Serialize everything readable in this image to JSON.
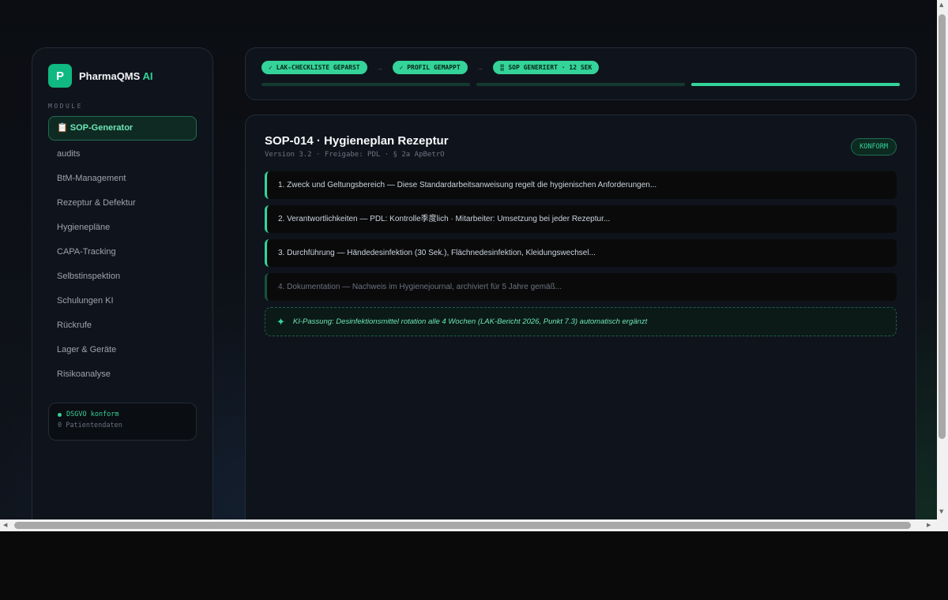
{
  "brand": {
    "logo_letter": "P",
    "name": "PharmaQMS",
    "suffix": "AI"
  },
  "sidebar": {
    "section_label": "MODULE",
    "items": [
      {
        "label": "📋 SOP-Generator",
        "active": true
      },
      {
        "label": "audits"
      },
      {
        "label": "BtM-Management"
      },
      {
        "label": "Rezeptur & Defektur"
      },
      {
        "label": "Hygienepläne"
      },
      {
        "label": "CAPA-Tracking"
      },
      {
        "label": "Selbstinspektion"
      },
      {
        "label": "Schulungen KI"
      },
      {
        "label": "Rückrufe"
      },
      {
        "label": "Lager & Geräte"
      },
      {
        "label": "Risikoanalyse"
      }
    ],
    "status": {
      "title": "DSGVO konform",
      "subtitle": "0 Patientendaten"
    }
  },
  "progress": {
    "steps": [
      "✓ LAK-CHECKLISTE GEPARST",
      "✓ PROFIL GEMAPPT",
      "⣿ SOP GENERIERT · 12 SEK"
    ],
    "arrow": "→",
    "bars": [
      0,
      0,
      1
    ]
  },
  "document": {
    "title": "SOP-014 · Hygieneplan Rezeptur",
    "meta": "Version 3.2 · Freigabe: PDL · § 2a ApBetrO",
    "badge": "KONFORM",
    "sections": [
      "1. Zweck und Geltungsbereich — Diese Standardarbeitsanweisung regelt die hygienischen Anforderungen...",
      "2. Verantwortlichkeiten — PDL: Kontrolle季度lich · Mitarbeiter: Umsetzung bei jeder Rezeptur...",
      "3. Durchführung — Händedesinfektion (30 Sek.), Flächnedesinfektion, Kleidungswechsel...",
      "4. Dokumentation — Nachweis im Hygienejournal, archiviert für 5 Jahre gemäß..."
    ],
    "ki_icon": "sparkle-icon",
    "ki_note": "KI-Passung: Desinfektionsmittel rotation alle 4 Wochen (LAK-Bericht 2026, Punkt 7.3) automatisch ergänzt"
  },
  "colors": {
    "accent": "#34d399",
    "background": "#0b0d12",
    "panel": "#0f141c"
  }
}
